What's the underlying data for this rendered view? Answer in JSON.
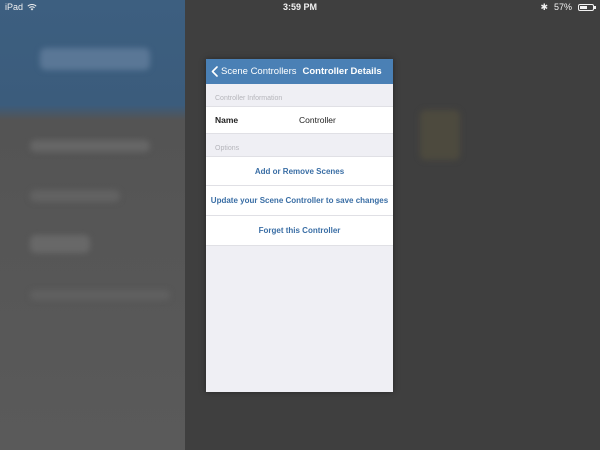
{
  "status_bar": {
    "device": "iPad",
    "wifi_icon": "wifi-icon",
    "time": "3:59 PM",
    "bluetooth_icon": "bluetooth-icon",
    "battery_percent_label": "57%",
    "battery_level": 0.57
  },
  "nav": {
    "back_label": "Scene Controllers",
    "title": "Controller Details",
    "bar_color": "#4a80b5"
  },
  "sections": {
    "info_header": "Controller Information",
    "name_label": "Name",
    "name_value": "Controller",
    "options_header": "Options"
  },
  "actions": {
    "add_remove": "Add or Remove Scenes",
    "update": "Update your Scene Controller to save changes",
    "forget": "Forget this Controller",
    "link_color": "#3a6ea5"
  }
}
